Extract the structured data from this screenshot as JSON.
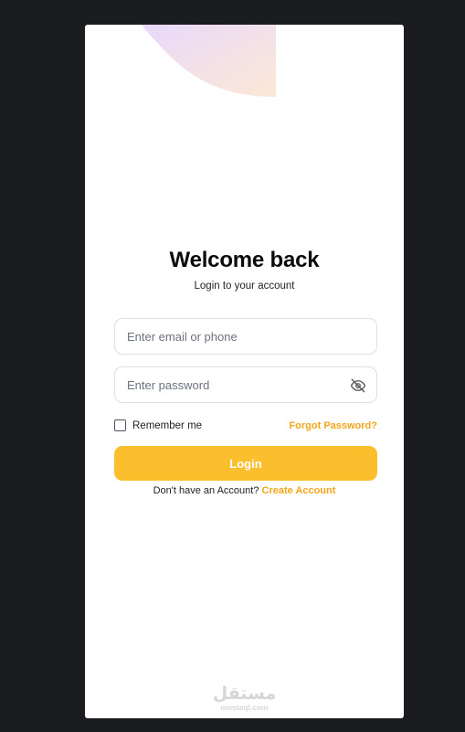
{
  "login": {
    "title": "Welcome back",
    "subtitle": "Login to your account",
    "email_placeholder": "Enter email or phone",
    "password_placeholder": "Enter password",
    "remember_label": "Remember me",
    "forgot_label": "Forgot Password?",
    "submit_label": "Login",
    "signup_prompt": "Don't have an Account?",
    "signup_link": "Create Account",
    "password_toggle_icon": "eye-off-icon",
    "remember_checked": false
  },
  "watermark": {
    "logo_text": "مستقل",
    "site": "mostaql.com"
  },
  "colors": {
    "page_background": "#1b1c1f",
    "card_background": "#ffffff",
    "accent": "#fbbf2d",
    "link": "#f4a51c",
    "blob_start": "#e9d8fb",
    "blob_end": "#fbe9d6"
  }
}
